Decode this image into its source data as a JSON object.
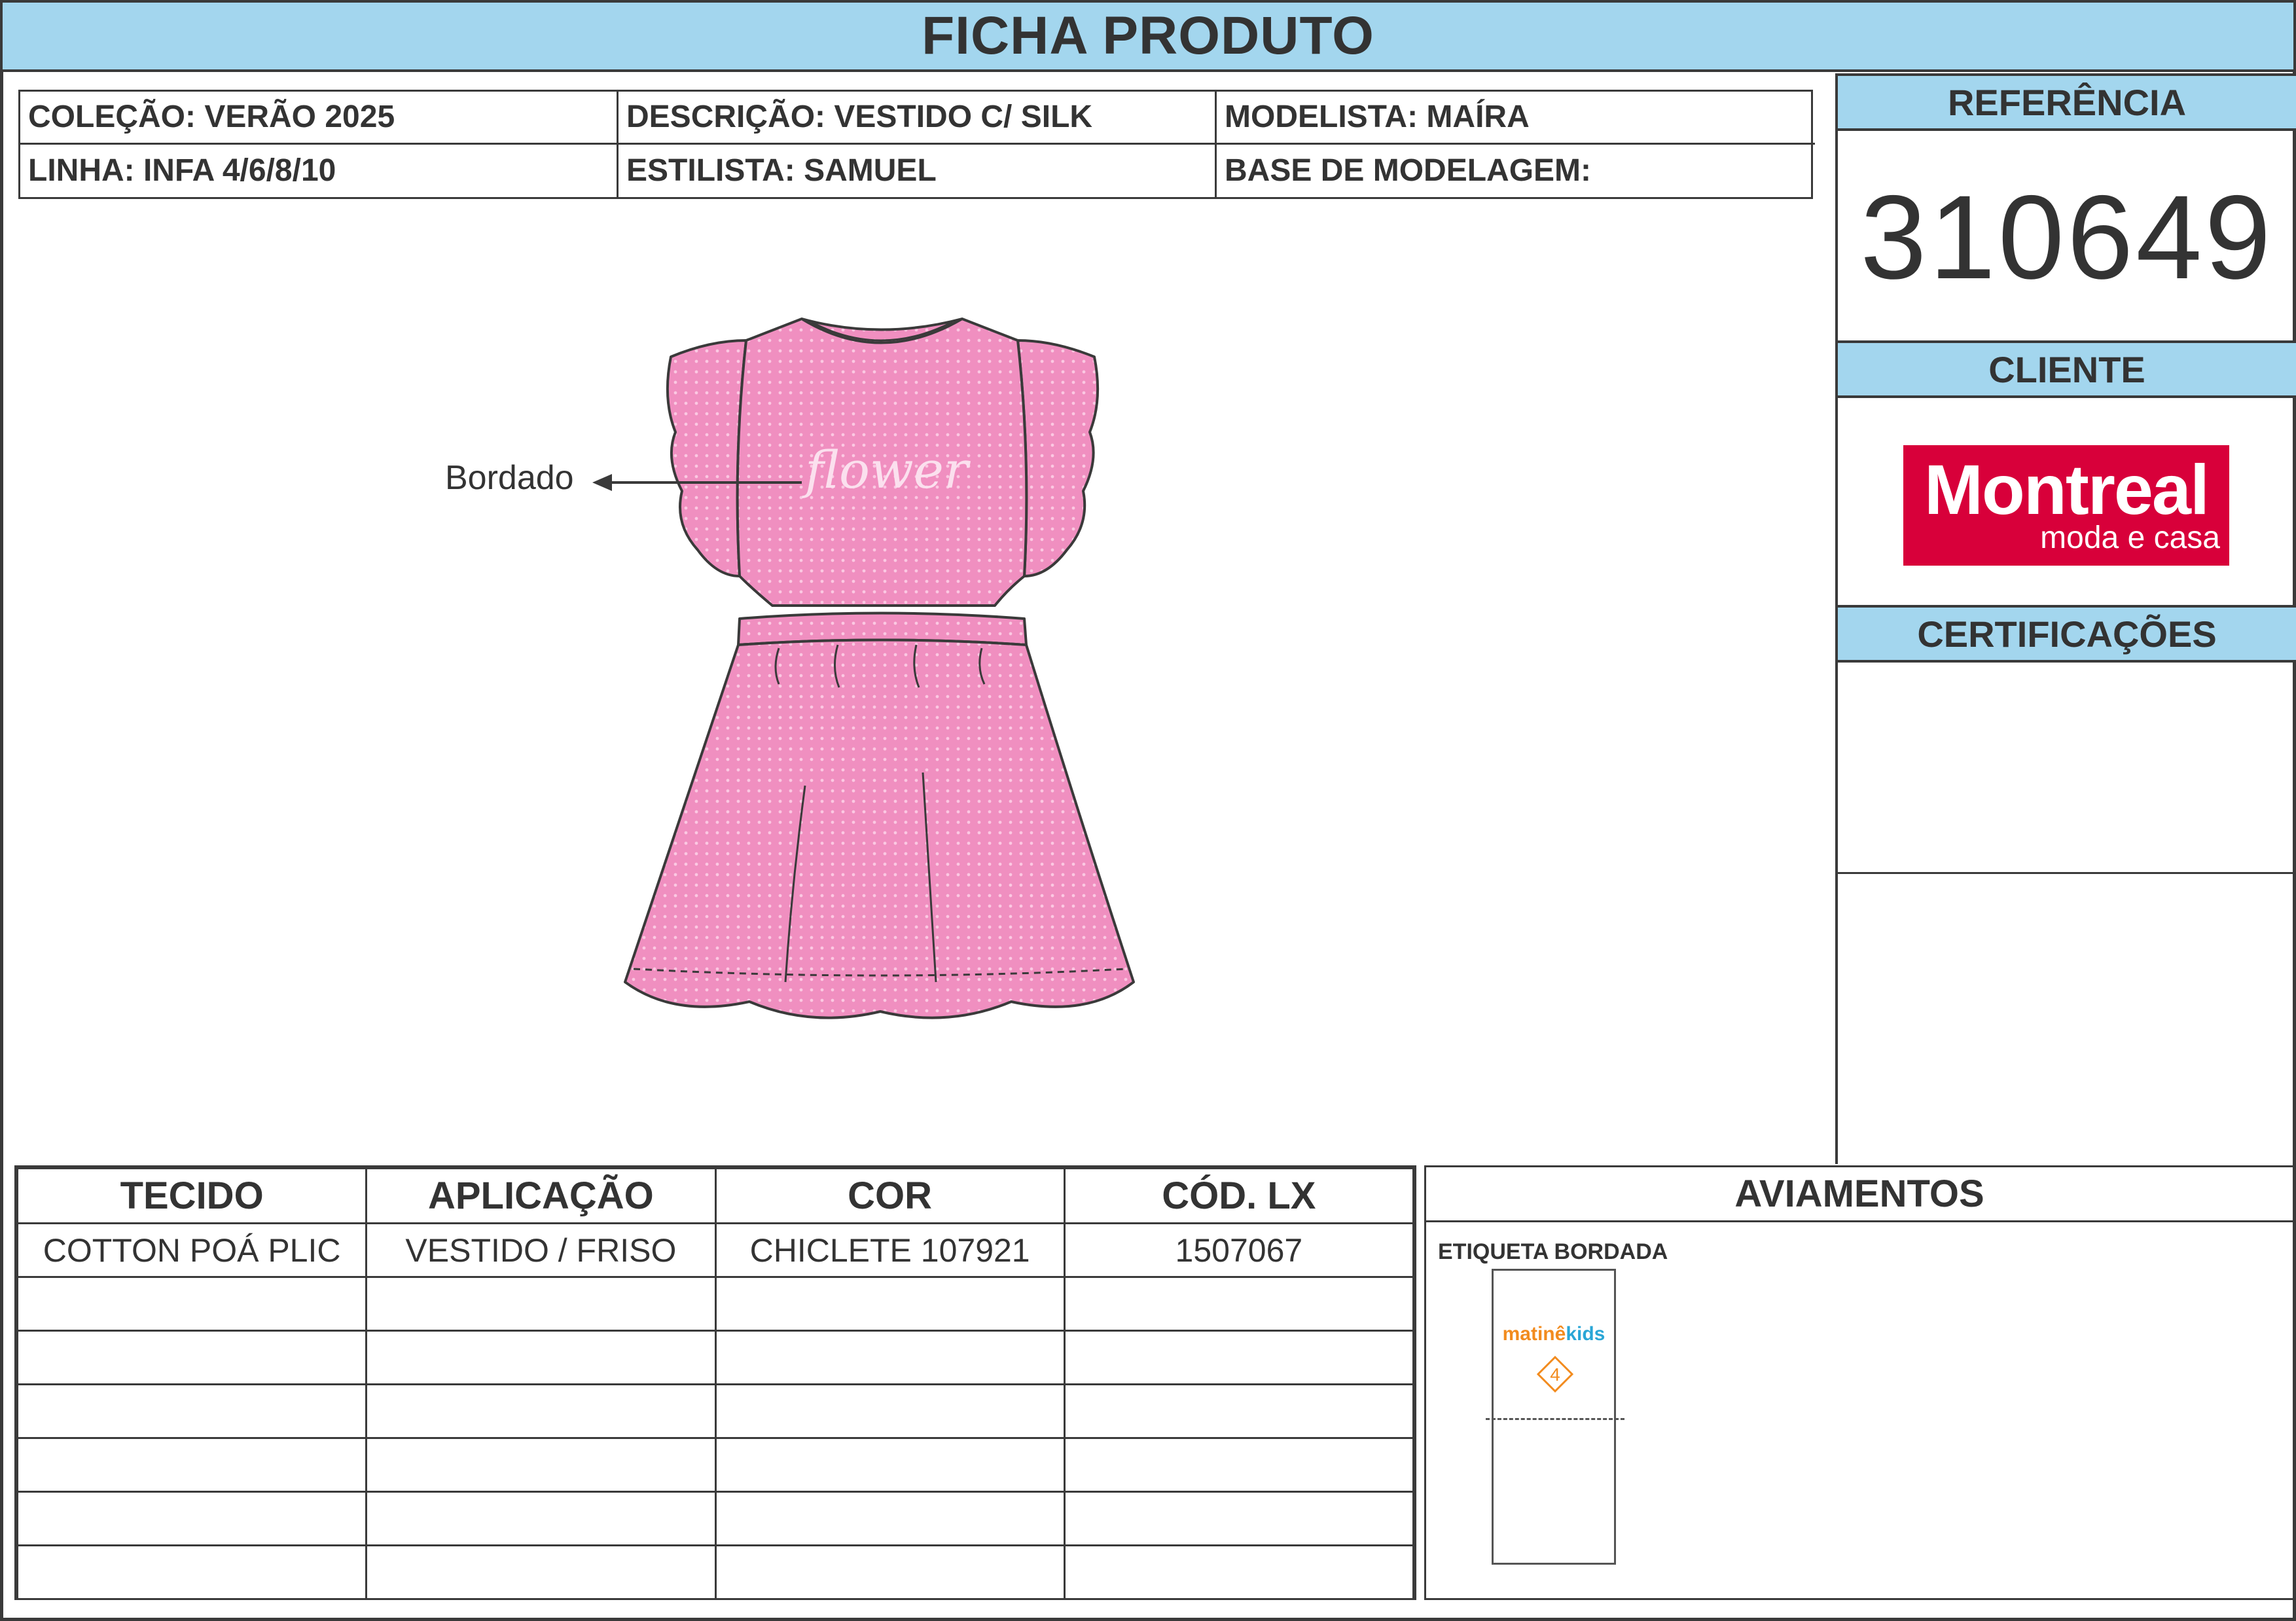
{
  "title": "FICHA PRODUTO",
  "info": {
    "colecao": "COLEÇÃO: VERÃO 2025",
    "descricao": "DESCRIÇÃO: VESTIDO C/ SILK",
    "modelista": "MODELISTA: MAÍRA",
    "linha": "LINHA: INFA 4/6/8/10",
    "estilista": "ESTILISTA: SAMUEL",
    "base": "BASE DE MODELAGEM:"
  },
  "sidebar": {
    "referencia_label": "REFERÊNCIA",
    "referencia": "310649",
    "cliente_label": "CLIENTE",
    "cliente_logo": {
      "brand": "Montreal",
      "tagline": "moda e casa",
      "color": "#d8003a"
    },
    "certificacoes_label": "CERTIFICAÇÕES"
  },
  "drawing": {
    "callout": "Bordado",
    "print_text": "flower",
    "fabric_color": "#f08fc0",
    "outline_color": "#3a3a3a"
  },
  "materials": {
    "headers": [
      "TECIDO",
      "APLICAÇÃO",
      "COR",
      "CÓD. LX"
    ],
    "rows": [
      [
        "COTTON POÁ PLIC",
        "VESTIDO / FRISO",
        "CHICLETE 107921",
        "1507067"
      ],
      [
        "",
        "",
        "",
        ""
      ],
      [
        "",
        "",
        "",
        ""
      ],
      [
        "",
        "",
        "",
        ""
      ],
      [
        "",
        "",
        "",
        ""
      ],
      [
        "",
        "",
        "",
        ""
      ],
      [
        "",
        "",
        "",
        ""
      ]
    ]
  },
  "aviamentos": {
    "title": "AVIAMENTOS",
    "item_label": "ETIQUETA BORDADA",
    "tag_brand_a": "matinê",
    "tag_brand_b": "kids",
    "tag_size": "4"
  },
  "colors": {
    "header_blue": "#a3d6ee",
    "border": "#3a3a3a"
  }
}
